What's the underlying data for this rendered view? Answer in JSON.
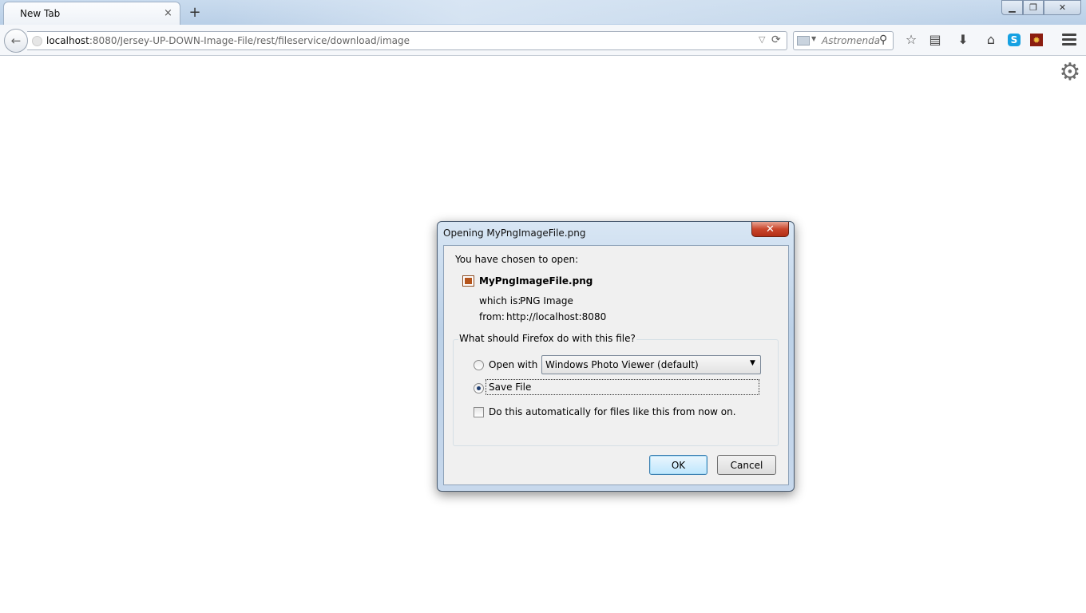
{
  "browser": {
    "tab_title": "New Tab",
    "tab_close": "×",
    "new_tab": "+",
    "url_host": "localhost",
    "url_rest": ":8080/Jersey-UP-DOWN-Image-File/rest/fileservice/download/image",
    "search_placeholder": "Astromenda",
    "icons": {
      "back": "back-arrow-icon",
      "reload": "reload-icon",
      "bookmark": "star-icon",
      "reading": "bookmarks-menu-icon",
      "downloads": "download-icon",
      "home": "home-icon",
      "skype": "skype-icon",
      "addon": "addon-icon",
      "menu": "hamburger-menu-icon",
      "settings": "gear-icon"
    }
  },
  "dialog": {
    "title": "Opening MyPngImageFile.png",
    "chosen_label": "You have chosen to open:",
    "file_name": "MyPngImageFile.png",
    "which_label": "which is:",
    "which_value": "PNG Image",
    "from_label": "from:",
    "from_value": "http://localhost:8080",
    "question": "What should Firefox do with this file?",
    "open_with_label": "Open with",
    "open_with_selected": "Windows Photo Viewer (default)",
    "save_file_label": "Save File",
    "selected_action": "save",
    "auto_label": "Do this automatically for files like this from now on.",
    "auto_checked": false,
    "ok_label": "OK",
    "cancel_label": "Cancel"
  }
}
